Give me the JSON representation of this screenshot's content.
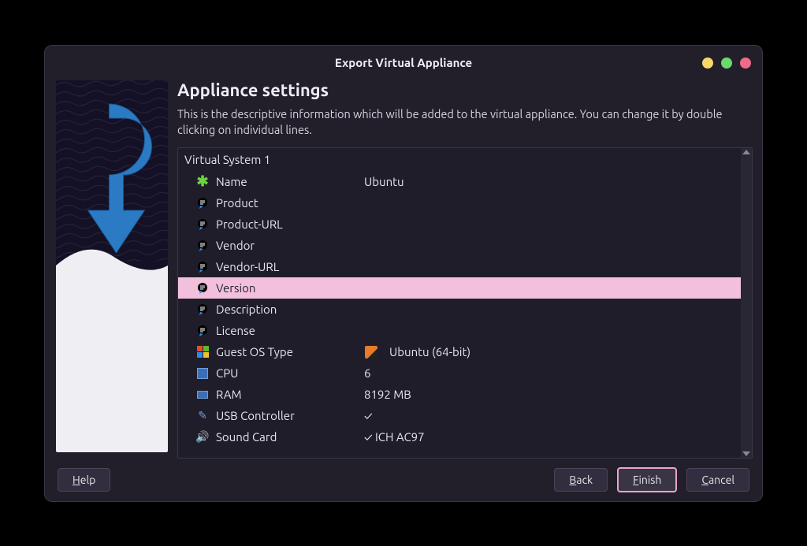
{
  "window": {
    "title": "Export Virtual Appliance"
  },
  "heading": "Appliance settings",
  "description": "This is the descriptive information which will be added to the virtual appliance. You can change it by double clicking on individual lines.",
  "system": {
    "group_label": "Virtual System 1",
    "rows": [
      {
        "icon": "asterisk",
        "label": "Name",
        "value": "Ubuntu"
      },
      {
        "icon": "bubble",
        "label": "Product",
        "value": ""
      },
      {
        "icon": "bubble",
        "label": "Product-URL",
        "value": ""
      },
      {
        "icon": "bubble",
        "label": "Vendor",
        "value": ""
      },
      {
        "icon": "bubble",
        "label": "Vendor-URL",
        "value": ""
      },
      {
        "icon": "bubble",
        "label": "Version",
        "value": "",
        "selected": true
      },
      {
        "icon": "bubble",
        "label": "Description",
        "value": ""
      },
      {
        "icon": "bubble",
        "label": "License",
        "value": ""
      },
      {
        "icon": "squares",
        "label": "Guest OS Type",
        "value": "Ubuntu (64-bit)",
        "value_icon": "os"
      },
      {
        "icon": "cpu",
        "label": "CPU",
        "value": "6"
      },
      {
        "icon": "ram",
        "label": "RAM",
        "value": "8192 MB"
      },
      {
        "icon": "usb",
        "label": "USB Controller",
        "value": "✓"
      },
      {
        "icon": "snd",
        "label": "Sound Card",
        "value": "✓  ICH AC97"
      }
    ]
  },
  "buttons": {
    "help": "Help",
    "back": "Back",
    "finish": "Finish",
    "cancel": "Cancel"
  }
}
